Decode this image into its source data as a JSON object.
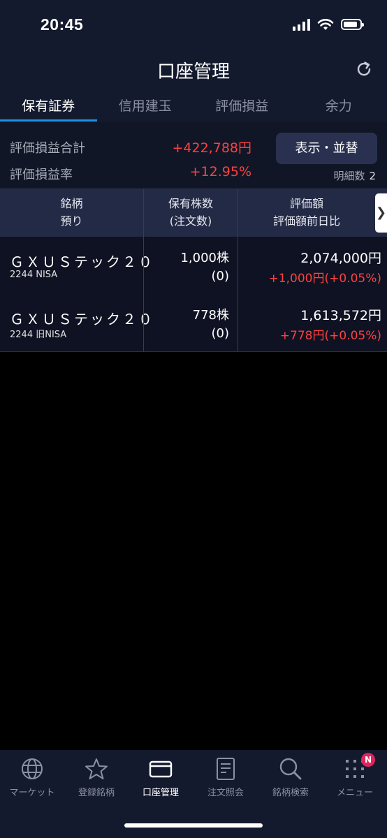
{
  "status": {
    "time": "20:45"
  },
  "header": {
    "title": "口座管理"
  },
  "tabs": [
    {
      "label": "保有証券",
      "active": true
    },
    {
      "label": "信用建玉",
      "active": false
    },
    {
      "label": "評価損益",
      "active": false
    },
    {
      "label": "余力",
      "active": false
    }
  ],
  "summary": {
    "total_label": "評価損益合計",
    "total_value": "+422,788円",
    "rate_label": "評価損益率",
    "rate_value": "+12.95%",
    "display_button": "表示・並替",
    "detail_label": "明細数",
    "detail_count": "2"
  },
  "table": {
    "headers": {
      "col1_line1": "銘柄",
      "col1_line2": "預り",
      "col2_line1": "保有株数",
      "col2_line2": "(注文数)",
      "col3_line1": "評価額",
      "col3_line2": "評価額前日比"
    },
    "rows": [
      {
        "name": "ＧＸＵＳテック２０",
        "code": "2244 NISA",
        "qty": "1,000株",
        "order": "(0)",
        "value": "2,074,000円",
        "change": "+1,000円(+0.05%)"
      },
      {
        "name": "ＧＸＵＳテック２０",
        "code": "2244 旧NISA",
        "qty": "778株",
        "order": "(0)",
        "value": "1,613,572円",
        "change": "+778円(+0.05%)"
      }
    ]
  },
  "tabbar": [
    {
      "label": "マーケット",
      "icon": "globe-icon"
    },
    {
      "label": "登録銘柄",
      "icon": "star-icon"
    },
    {
      "label": "口座管理",
      "icon": "card-icon",
      "active": true
    },
    {
      "label": "注文照会",
      "icon": "document-icon"
    },
    {
      "label": "銘柄検索",
      "icon": "search-icon"
    },
    {
      "label": "メニュー",
      "icon": "grid-icon",
      "badge": "N"
    }
  ],
  "colors": {
    "accent": "#1e90e6",
    "positive": "#ff4040",
    "badge": "#e0245e"
  }
}
